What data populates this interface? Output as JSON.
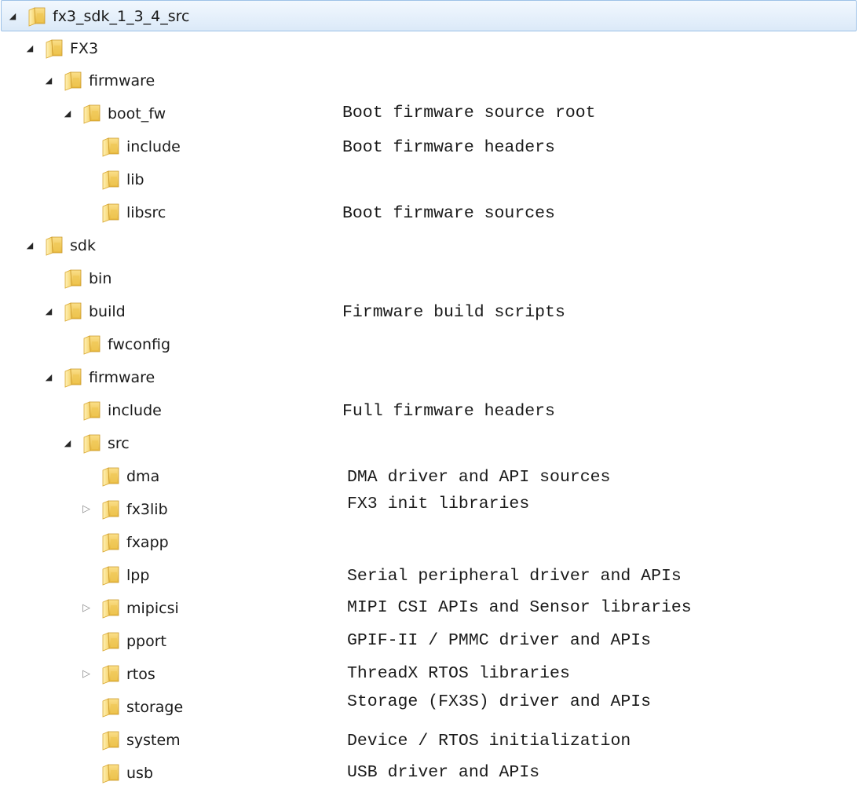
{
  "tree": {
    "items": [
      {
        "name": "fx3_sdk_1_3_4_src",
        "expander": "expanded",
        "selected": true,
        "description": ""
      },
      {
        "name": "FX3",
        "expander": "expanded",
        "description": ""
      },
      {
        "name": "firmware",
        "expander": "expanded",
        "description": ""
      },
      {
        "name": "boot_fw",
        "expander": "expanded",
        "description": "Boot firmware source root"
      },
      {
        "name": "include",
        "expander": "none",
        "description": "Boot firmware headers"
      },
      {
        "name": "lib",
        "expander": "none",
        "description": ""
      },
      {
        "name": "libsrc",
        "expander": "none",
        "description": "Boot firmware sources"
      },
      {
        "name": "sdk",
        "expander": "expanded",
        "description": ""
      },
      {
        "name": "bin",
        "expander": "none",
        "description": ""
      },
      {
        "name": "build",
        "expander": "expanded",
        "description": "Firmware build scripts"
      },
      {
        "name": "fwconfig",
        "expander": "none",
        "description": ""
      },
      {
        "name": "firmware",
        "expander": "expanded",
        "description": ""
      },
      {
        "name": "include",
        "expander": "none",
        "description": "Full firmware headers"
      },
      {
        "name": "src",
        "expander": "expanded",
        "description": ""
      },
      {
        "name": "dma",
        "expander": "none",
        "description": "DMA driver and API sources"
      },
      {
        "name": "fx3lib",
        "expander": "collapsed",
        "description": "FX3 init libraries"
      },
      {
        "name": "fxapp",
        "expander": "none",
        "description": ""
      },
      {
        "name": "lpp",
        "expander": "none",
        "description": "Serial peripheral driver and APIs"
      },
      {
        "name": "mipicsi",
        "expander": "collapsed",
        "description": "MIPI CSI APIs and Sensor libraries"
      },
      {
        "name": "pport",
        "expander": "none",
        "description": "GPIF-II / PMMC driver and APIs"
      },
      {
        "name": "rtos",
        "expander": "collapsed",
        "description": "ThreadX RTOS libraries"
      },
      {
        "name": "storage",
        "expander": "none",
        "description": "Storage (FX3S) driver and APIs"
      },
      {
        "name": "system",
        "expander": "none",
        "description": "Device / RTOS initialization"
      },
      {
        "name": "usb",
        "expander": "none",
        "description": "USB driver and APIs"
      }
    ],
    "icons": {
      "expanded": "triangle-expanded-icon",
      "collapsed": "triangle-collapsed-icon",
      "folder": "folder-icon"
    },
    "colors": {
      "selection_bg": "#dbe9f8",
      "selection_border": "#9dc1e7",
      "folder_yellow": "#f3c94f"
    }
  }
}
